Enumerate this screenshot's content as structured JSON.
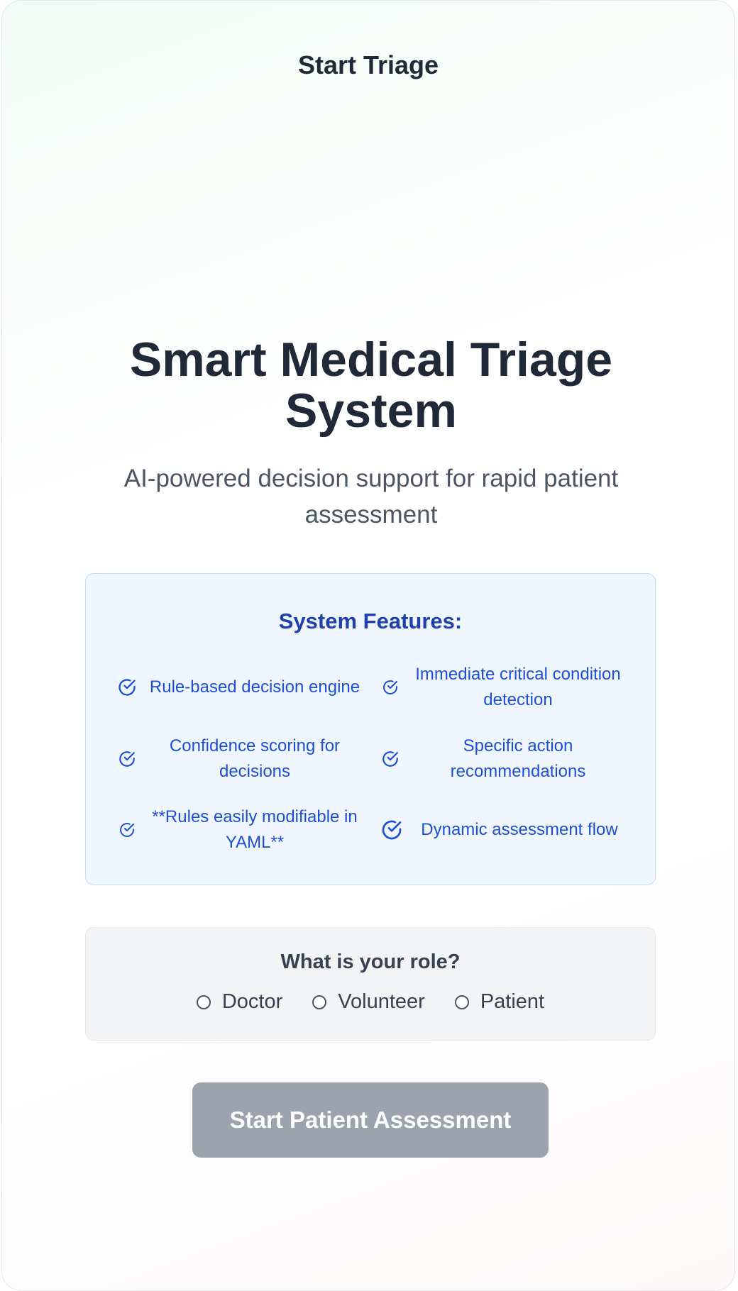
{
  "header": {
    "title": "Start Triage"
  },
  "hero": {
    "title": "Smart Medical Triage System",
    "subtitle": "AI-powered decision support for rapid patient assessment"
  },
  "features": {
    "title": "System Features:",
    "items": [
      {
        "text": "Rule-based decision engine",
        "icon": "check-circle-icon"
      },
      {
        "text": "Immediate critical condition detection",
        "icon": "check-circle-icon"
      },
      {
        "text": "Confidence scoring for decisions",
        "icon": "check-circle-icon"
      },
      {
        "text": "Specific action recommendations",
        "icon": "check-circle-icon"
      },
      {
        "text": "**Rules easily modifiable in YAML**",
        "icon": "check-circle-icon"
      },
      {
        "text": "Dynamic assessment flow",
        "icon": "check-circle-icon"
      }
    ]
  },
  "role": {
    "question": "What is your role?",
    "options": [
      "Doctor",
      "Volunteer",
      "Patient"
    ]
  },
  "actions": {
    "start_label": "Start Patient Assessment"
  },
  "colors": {
    "accent": "#1d4ed8",
    "features_bg": "#eff6ff",
    "button_disabled": "#9ca3af",
    "text_dark": "#1f2937"
  }
}
